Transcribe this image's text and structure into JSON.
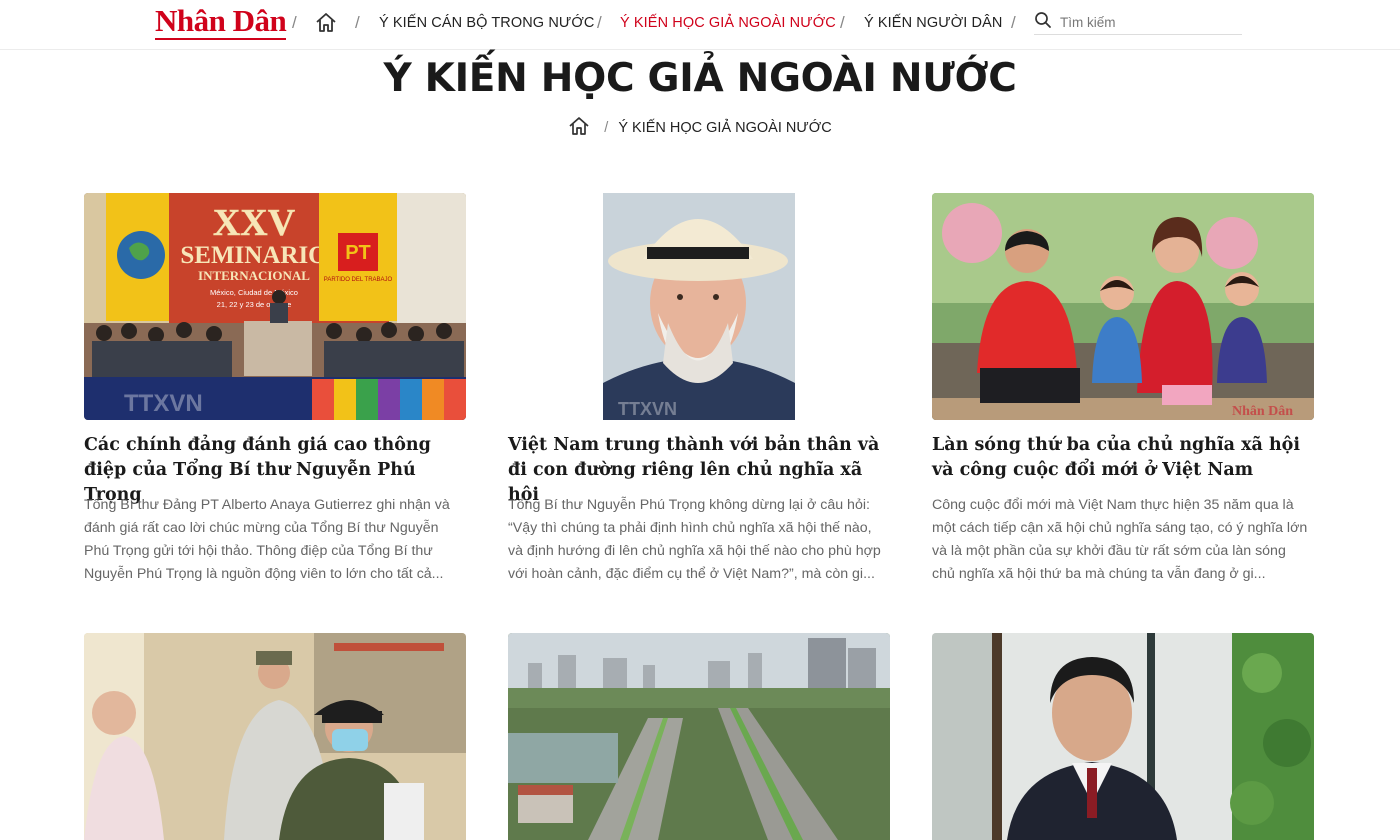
{
  "nav": {
    "logo": "Nhân Dân",
    "items": [
      {
        "label": "Ý KIẾN CÁN BỘ TRONG NƯỚC",
        "active": false
      },
      {
        "label": "Ý KIẾN HỌC GIẢ NGOÀI NƯỚC",
        "active": true
      },
      {
        "label": "Ý KIẾN NGƯỜI DÂN",
        "active": false
      }
    ],
    "search_placeholder": "Tìm kiếm"
  },
  "page": {
    "title": "Ý KIẾN HỌC GIẢ NGOÀI NƯỚC",
    "breadcrumb": "Ý KIẾN HỌC GIẢ NGOÀI NƯỚC"
  },
  "articles": [
    {
      "headline": "Các chính đảng đánh giá cao thông điệp của Tổng Bí thư Nguyễn Phú Trọng",
      "excerpt": "Tổng Bí thư Đảng PT Alberto Anaya Gutierrez ghi nhận và đánh giá rất cao lời chúc mừng của Tổng Bí thư Nguyễn Phú Trọng gửi tới hội thảo. Thông điệp của Tổng Bí thư Nguyễn Phú Trọng là nguồn động viên to lớn cho tất cả...",
      "image": {
        "banner_big": "XXV",
        "banner_line1": "SEMINARIO",
        "banner_line2": "INTERNACIONAL",
        "banner_line3": "México, Ciudad de México",
        "banner_line4": "21, 22 y 23 de octubre",
        "party_logo": "PT",
        "party_name": "PARTIDO DEL TRABAJO",
        "watermark": "TTXVN"
      }
    },
    {
      "headline": "Việt Nam trung thành với bản thân và đi con đường riêng lên chủ nghĩa xã hội",
      "excerpt": "Tổng Bí thư Nguyễn Phú Trọng không dừng lại ở câu hỏi: “Vậy thì chúng ta phải định hình chủ nghĩa xã hội thế nào, và định hướng đi lên chủ nghĩa xã hội thế nào cho phù hợp với hoàn cảnh, đặc điểm cụ thể ở Việt Nam?”, mà còn gi...",
      "image": {
        "watermark": "TTXVN"
      }
    },
    {
      "headline": "Làn sóng thứ ba của chủ nghĩa xã hội và công cuộc đổi mới ở Việt Nam",
      "excerpt": "Công cuộc đổi mới mà Việt Nam thực hiện 35 năm qua là một cách tiếp cận xã hội chủ nghĩa sáng tạo, có ý nghĩa lớn và là một phần của sự khởi đầu từ rất sớm của làn sóng chủ nghĩa xã hội thứ ba mà chúng ta vẫn đang ở gi...",
      "image": {
        "watermark": "Nhân Dân"
      }
    },
    {
      "headline": "",
      "excerpt": "",
      "image": {}
    },
    {
      "headline": "",
      "excerpt": "",
      "image": {}
    },
    {
      "headline": "",
      "excerpt": "",
      "image": {}
    }
  ],
  "colors": {
    "brand_red": "#d0021b",
    "text_dark": "#1a1a1a",
    "text_muted": "#666666"
  },
  "icons": {
    "home": "home-icon",
    "search": "search-icon"
  }
}
